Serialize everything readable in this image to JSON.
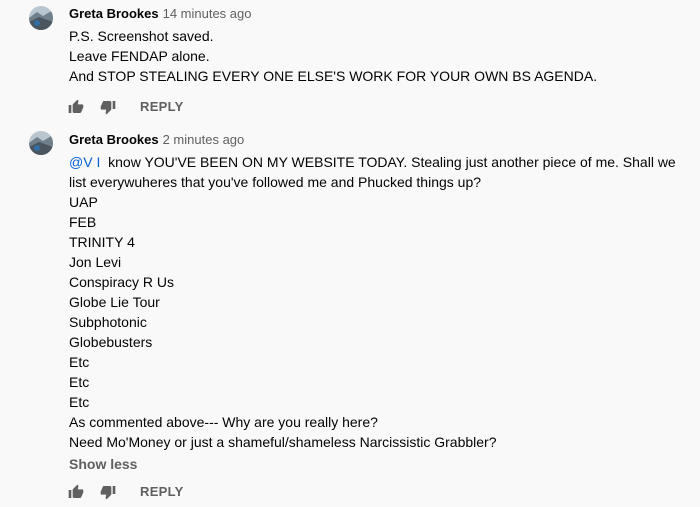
{
  "comments": [
    {
      "author": "Greta Brookes",
      "time": "14 minutes ago",
      "lines": [
        "P.S. Screenshot saved.",
        "Leave FENDAP alone.",
        "And STOP STEALING EVERY ONE ELSE'S WORK FOR YOUR OWN BS AGENDA."
      ],
      "reply_label": "REPLY"
    },
    {
      "author": "Greta Brookes",
      "time": "2 minutes ago",
      "mention": "@V I",
      "first_line_rest": "  know YOU'VE BEEN ON MY WEBSITE TODAY. Stealing just another piece of me. Shall we",
      "lines": [
        "list everywuheres that you've followed me and Phucked things up?",
        "UAP",
        "FEB",
        "TRINITY 4",
        "Jon Levi",
        "Conspiracy R Us",
        "Globe Lie Tour",
        "Subphotonic",
        "Globebusters",
        "Etc",
        "Etc",
        "Etc",
        "As commented above--- Why are you really here?",
        "Need Mo'Money or just a shameful/shameless Narcissistic Grabbler?"
      ],
      "show_less_label": "Show less",
      "reply_label": "REPLY"
    }
  ],
  "icons": {
    "like": "thumb-up-icon",
    "dislike": "thumb-down-icon"
  },
  "colors": {
    "link": "#065fd4",
    "secondary": "#606060",
    "text": "#030303"
  }
}
